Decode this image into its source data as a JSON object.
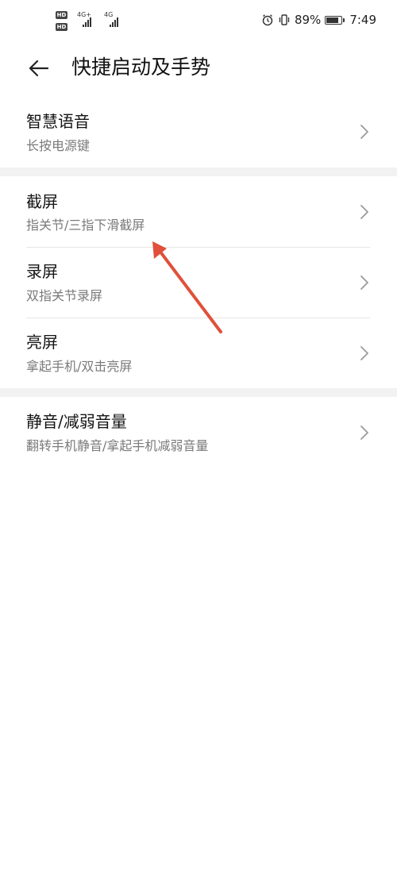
{
  "status_bar": {
    "hd1": "HD",
    "hd2": "HD",
    "sig1": "4G+",
    "sig2": "4G",
    "battery_percent": 89,
    "battery_text": "89%",
    "time": "7:49"
  },
  "header": {
    "title": "快捷启动及手势"
  },
  "sections": [
    {
      "items": [
        {
          "title": "智慧语音",
          "subtitle": "长按电源键"
        }
      ]
    },
    {
      "items": [
        {
          "title": "截屏",
          "subtitle": "指关节/三指下滑截屏"
        },
        {
          "title": "录屏",
          "subtitle": "双指关节录屏"
        },
        {
          "title": "亮屏",
          "subtitle": "拿起手机/双击亮屏"
        }
      ]
    },
    {
      "items": [
        {
          "title": "静音/减弱音量",
          "subtitle": "翻转手机静音/拿起手机减弱音量"
        }
      ]
    }
  ],
  "colors": {
    "annotation_arrow": "#e0503a",
    "section_gap": "#f2f2f2",
    "subtitle_text": "#7a7a7a"
  },
  "icons": {
    "back": "arrow-left-icon",
    "chevron": "chevron-right-icon",
    "alarm": "alarm-icon",
    "vibrate": "vibrate-icon",
    "battery": "battery-icon"
  }
}
